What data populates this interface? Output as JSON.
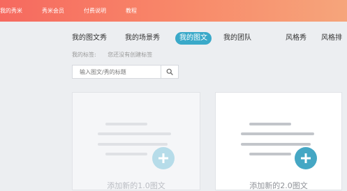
{
  "topnav": {
    "items": [
      {
        "label": "我的秀米"
      },
      {
        "label": "秀米会员"
      },
      {
        "label": "付费说明"
      },
      {
        "label": "教程"
      }
    ]
  },
  "tabs": [
    {
      "label": "我的图文秀",
      "active": false
    },
    {
      "label": "我的场景秀",
      "active": false
    },
    {
      "label": "我的图文",
      "active": true
    },
    {
      "label": "我的团队",
      "active": false
    },
    {
      "label": "风格秀",
      "active": false
    },
    {
      "label": "风格排",
      "active": false
    }
  ],
  "tags": {
    "label": "我的标签:",
    "empty_text": "您还没有创建标签"
  },
  "search": {
    "placeholder": "输入图文/秀的标题",
    "icon": "search-icon"
  },
  "cards": [
    {
      "label": "添加新的1.0图文",
      "icon": "plus-icon"
    },
    {
      "label": "添加新的2.0图文",
      "icon": "plus-icon"
    }
  ],
  "colors": {
    "topbar_start": "#f6695f",
    "topbar_end": "#f6a57b",
    "accent": "#3aa9c9"
  }
}
